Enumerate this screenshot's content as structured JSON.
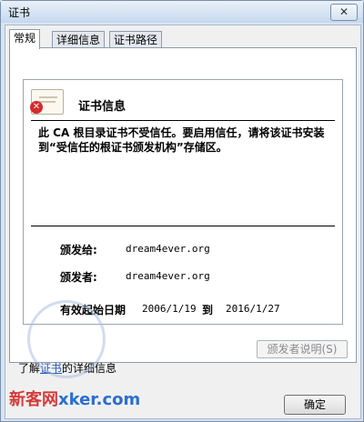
{
  "window": {
    "title": "证书",
    "close_glyph": "✕"
  },
  "tabs": [
    {
      "label": "常规",
      "active": true
    },
    {
      "label": "详细信息",
      "active": false
    },
    {
      "label": "证书路径",
      "active": false
    }
  ],
  "cert": {
    "info_title": "证书信息",
    "warning": "此 CA 根目录证书不受信任。要启用信任，请将该证书安装到“受信任的根证书颁发机构”存储区。",
    "issued_to_label": "颁发给:",
    "issued_to_value": "dream4ever.org",
    "issued_by_label": "颁发者:",
    "issued_by_value": "dream4ever.org",
    "valid_label": "有效起始日期",
    "valid_from": "2006/1/19",
    "valid_to_label": "到",
    "valid_to": "2016/1/27"
  },
  "issuer_statement_button": "颁发者说明(S)",
  "learn_more": {
    "prefix": "了解",
    "link": "证书",
    "suffix": "的详细信息"
  },
  "ok_button": "确定",
  "watermark": {
    "text": "新客网",
    "sub": "xker.com"
  },
  "colors": {
    "accent": "#2a58b8",
    "error": "#d42a2a",
    "watermark": "#d43b3b"
  }
}
